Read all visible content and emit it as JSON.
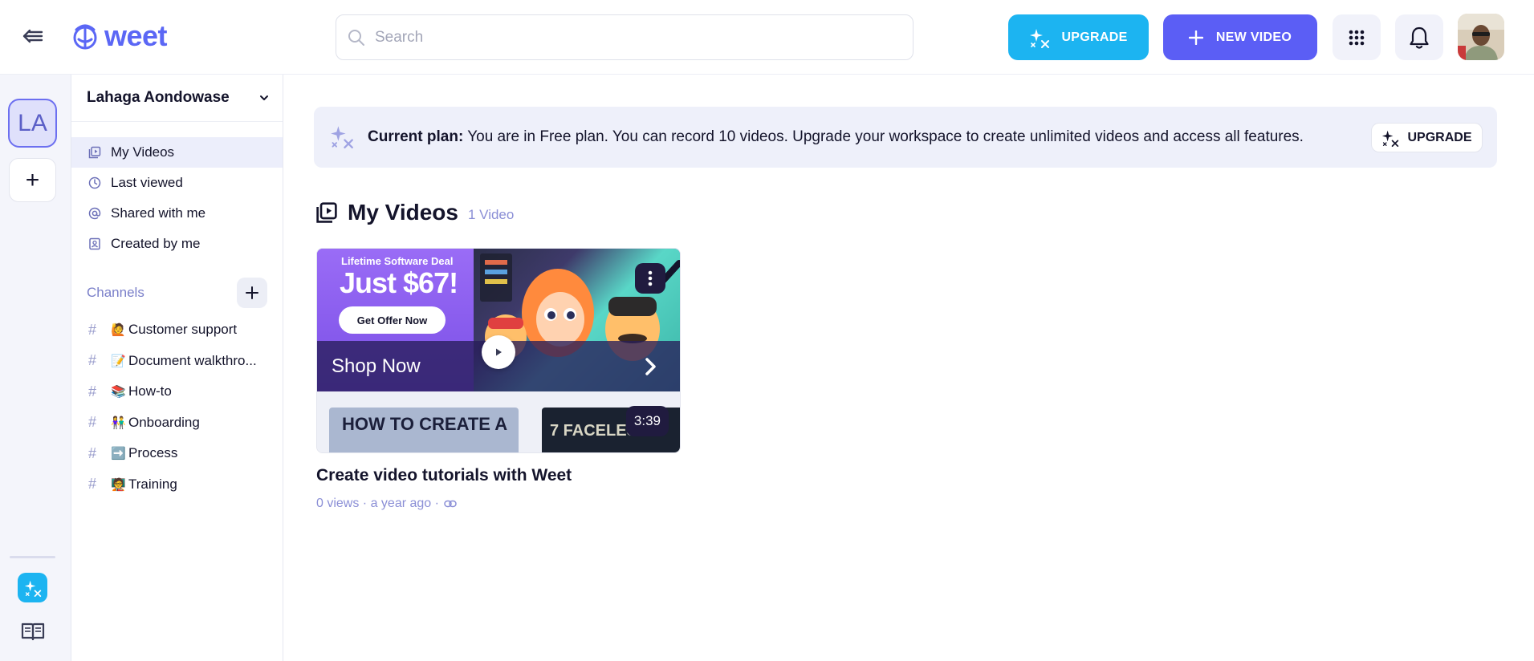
{
  "header": {
    "logo_text": "weet",
    "search_placeholder": "Search",
    "upgrade_label": "UPGRADE",
    "new_video_label": "NEW VIDEO",
    "brand_color": "#5b67f5",
    "upgrade_color": "#1cb4f1"
  },
  "rail": {
    "workspace_initials": "LA",
    "add_label": "+"
  },
  "sidebar": {
    "workspace_name": "Lahaga Aondowase",
    "nav": [
      {
        "label": "My Videos",
        "icon": "video-library-icon"
      },
      {
        "label": "Last viewed",
        "icon": "clock-icon"
      },
      {
        "label": "Shared with me",
        "icon": "at-icon"
      },
      {
        "label": "Created by me",
        "icon": "profile-icon"
      }
    ],
    "channels_label": "Channels",
    "channels": [
      {
        "emoji": "🙋",
        "label": "Customer support"
      },
      {
        "emoji": "📝",
        "label": "Document walkthro..."
      },
      {
        "emoji": "📚",
        "label": "How-to"
      },
      {
        "emoji": "👫",
        "label": "Onboarding"
      },
      {
        "emoji": "➡️",
        "label": "Process"
      },
      {
        "emoji": "🧑‍🏫",
        "label": "Training"
      }
    ]
  },
  "banner": {
    "label": "Current plan:",
    "text": " You are in Free plan. You can record 10 videos. Upgrade your workspace to create unlimited videos and access all features.",
    "upgrade_label": "UPGRADE"
  },
  "main": {
    "title": "My Videos",
    "count": "1 Video"
  },
  "video": {
    "ad_deal": "Lifetime Software Deal",
    "ad_price": "Just $67!",
    "ad_offer": "Get Offer Now",
    "ad_shop": "Shop Now",
    "lower_left_text": "HOW TO CREATE A",
    "lower_right_text": "7 FACELES",
    "duration": "3:39",
    "title": "Create video tutorials with Weet",
    "meta": "0 views · a year ago ·"
  }
}
